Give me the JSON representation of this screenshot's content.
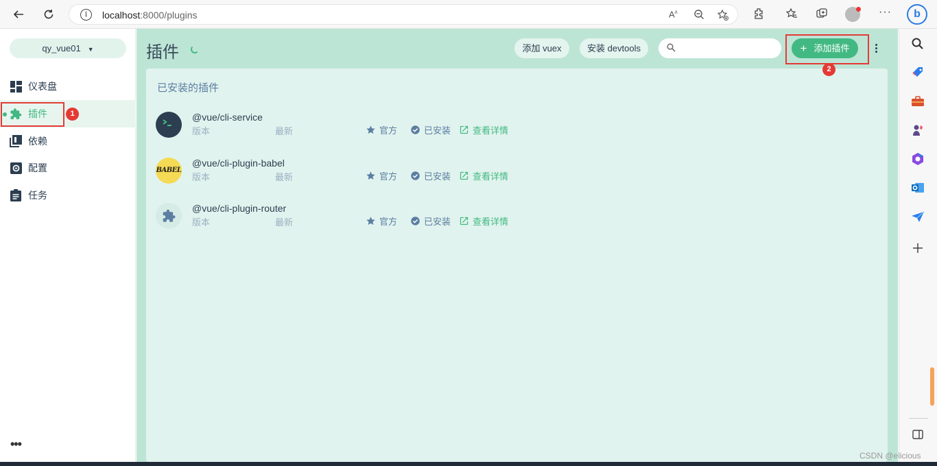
{
  "browser": {
    "url_host": "localhost",
    "url_path": ":8000/plugins"
  },
  "sidebar": {
    "project": "qy_vue01",
    "items": [
      {
        "label": "仪表盘",
        "icon": "dashboard-icon"
      },
      {
        "label": "插件",
        "icon": "puzzle-icon",
        "active": true
      },
      {
        "label": "依赖",
        "icon": "library-books-icon"
      },
      {
        "label": "配置",
        "icon": "settings-icon"
      },
      {
        "label": "任务",
        "icon": "assignment-icon"
      }
    ],
    "more": "•••"
  },
  "header": {
    "title": "插件",
    "add_vuex": "添加 vuex",
    "install_devtools": "安装 devtools",
    "search_placeholder": "",
    "add_plugin": "添加插件"
  },
  "annotations": {
    "badge1": "1",
    "badge2": "2"
  },
  "panel": {
    "title": "已安装的插件",
    "plugins": [
      {
        "name": "@vue/cli-service",
        "version_label": "版本",
        "latest_label": "最新",
        "official": "官方",
        "installed": "已安装",
        "details": "查看详情",
        "logo": "terminal-logo"
      },
      {
        "name": "@vue/cli-plugin-babel",
        "version_label": "版本",
        "latest_label": "最新",
        "official": "官方",
        "installed": "已安装",
        "details": "查看详情",
        "logo": "babel-logo",
        "logo_text": "BABEL"
      },
      {
        "name": "@vue/cli-plugin-router",
        "version_label": "版本",
        "latest_label": "最新",
        "official": "官方",
        "installed": "已安装",
        "details": "查看详情",
        "logo": "puzzle-logo"
      }
    ]
  },
  "watermark": "CSDN @elicious",
  "colors": {
    "accent": "#42b983",
    "main_bg": "#bde5d6",
    "panel_bg": "#e1f3ee",
    "annotation_red": "#e53935"
  }
}
